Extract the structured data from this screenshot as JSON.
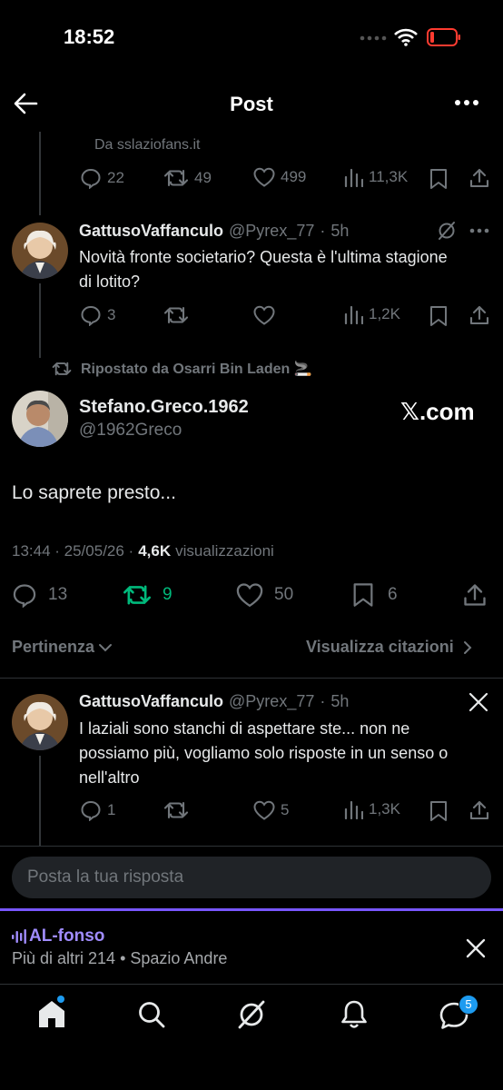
{
  "status_bar": {
    "time": "18:52"
  },
  "header": {
    "title": "Post"
  },
  "tweet1": {
    "source": "Da sslaziofans.it",
    "replies": "22",
    "reposts": "49",
    "likes": "499",
    "views": "11,3K"
  },
  "tweet2": {
    "name": "GattusoVaffanculo",
    "handle": "@Pyrex_77",
    "sep": "·",
    "time": "5h",
    "text": "Novità fronte societario? Questa è l'ultima stagione di lotito?",
    "replies": "3",
    "views": "1,2K"
  },
  "main_post": {
    "reposted_by": "Ripostato da Osarri Bin Laden 🚬",
    "name": "Stefano.Greco.1962",
    "handle": "@1962Greco",
    "brand": "𝕏.com",
    "text": "Lo saprete presto...",
    "meta_time": "13:44 · 25/05/26 ·",
    "views_count": "4,6K",
    "views_label": "visualizzazioni",
    "replies": "13",
    "reposts": "9",
    "likes": "50",
    "bookmarks": "6"
  },
  "sort": {
    "label": "Pertinenza",
    "quotes": "Visualizza citazioni"
  },
  "reply1": {
    "name": "GattusoVaffanculo",
    "handle": "@Pyrex_77",
    "sep": "·",
    "time": "5h",
    "text": "I laziali sono stanchi di aspettare ste... non ne possiamo più, vogliamo solo risposte in un senso o nell'altro",
    "replies": "1",
    "likes": "5",
    "views": "1,3K"
  },
  "reply_input": {
    "placeholder": "Posta la tua risposta"
  },
  "space": {
    "title": "AL-fonso",
    "subtitle": "Più di altri 214 • Spazio Andre"
  },
  "bottom_nav": {
    "messages_badge": "5"
  },
  "colors": {
    "accent": "#1d9bf0",
    "repost_green": "#00ba7c",
    "spaces_purple": "#7856ff"
  }
}
